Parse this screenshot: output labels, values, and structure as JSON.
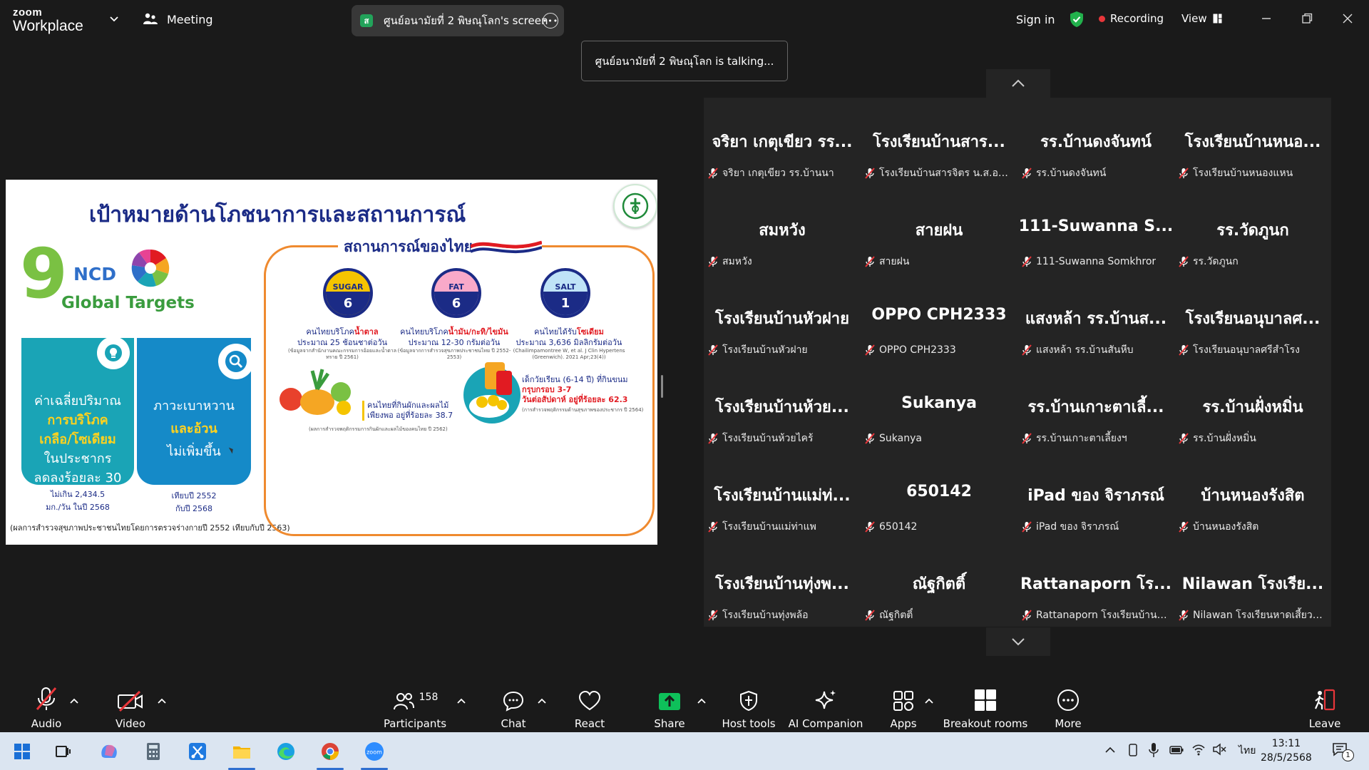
{
  "topbar": {
    "logo_line1": "zoom",
    "logo_line2": "Workplace",
    "meeting_label": "Meeting",
    "share_label": "ศูนย์อนามัยที่ 2 พิษณุโลก's screen",
    "signin": "Sign in",
    "recording": "Recording",
    "view": "View"
  },
  "talking": "ศูนย์อนามัยที่ 2 พิษณุโลก is talking...",
  "slide": {
    "title": "เป้าหมายด้านโภชนาการและสถานการณ์",
    "ncd_number": "9",
    "ncd": "NCD",
    "global_targets": "Global Targets",
    "card1": {
      "l1": "ค่าเฉลี่ยปริมาณ",
      "l2": "การบริโภค",
      "l3": "เกลือ/โซเดียม",
      "l4": "ในประชากร",
      "l5": "ลดลงร้อยละ 30"
    },
    "card1_sub": [
      "ไม่เกิน 2,434.5",
      "มก./วัน ในปี 2568"
    ],
    "card2": {
      "l1": "ภาวะเบาหวาน",
      "l2": "และอ้วน",
      "l3": "ไม่เพิ่มขึ้น"
    },
    "card2_sub": [
      "เทียบปี 2552",
      "กับปี 2568"
    ],
    "footnote": "(ผลการสำรวจสุขภาพประชาชนไทยโดยการตรวจร่างกายปี 2552 เทียบกับปี 2563)",
    "thai_title": "สถานการณ์ของไทย",
    "stats": [
      {
        "label": "SUGAR",
        "num": "6",
        "l1": "คนไทยบริโภค",
        "hl": "น้ำตาล",
        "l2": "ประมาณ 25 ช้อนชาต่อวัน",
        "src": "(ข้อมูลจากสำนักงานคณะกรรมการอ้อยและน้ำตาลทราย ปี 2561)"
      },
      {
        "label": "FAT",
        "num": "6",
        "l1": "คนไทยบริโภค",
        "hl": "น้ำมัน/กะทิ/ไขมัน",
        "l2": "ประมาณ 12-30 กรัมต่อวัน",
        "src": "(ข้อมูลจากการสำรวจสุขภาพประชาชนไทย ปี 2552-2553)"
      },
      {
        "label": "SALT",
        "num": "1",
        "l1": "คนไทยได้รับ",
        "hl": "โซเดียม",
        "l2": "ประมาณ 3,636 มิลลิกรัมต่อวัน",
        "src": "(Chailimpamontree W, et al. J Clin Hypertens (Greenwich). 2021 Apr;23(4))"
      }
    ],
    "veg_l1": "คนไทยที่กินผักและผลไม้",
    "veg_l2": "เพียงพอ อยู่ที่ร้อยละ 38.7",
    "veg_src": "(ผลการสำรวจพฤติกรรมการกินผักและผลไม้ของคนไทย ปี 2562)",
    "kid_l1": "เด็กวัยเรียน (6-14 ปี) ที่กินขนม",
    "kid_l2": "กรุบกรอบ 3-7",
    "kid_l3": "วันต่อสัปดาห์ อยู่ที่ร้อยละ 62.3",
    "kid_src": "(การสำรวจพฤติกรรมด้านสุขภาพของประชากร ปี 2564)"
  },
  "participants": [
    {
      "big": "จริยา เกตุเขียว รร...",
      "name": "จริยา เกตุเขียว รร.บ้านนา"
    },
    {
      "big": "โรงเรียนบ้านสาร...",
      "name": "โรงเรียนบ้านสารจิตร น.ส.อนุสรา"
    },
    {
      "big": "รร.บ้านดงจันทน์",
      "name": "รร.บ้านดงจันทน์"
    },
    {
      "big": "โรงเรียนบ้านหนอ...",
      "name": "โรงเรียนบ้านหนองแหน"
    },
    {
      "big": "สมหวัง",
      "name": "สมหวัง"
    },
    {
      "big": "สายฝน",
      "name": "สายฝน"
    },
    {
      "big": "111-Suwanna S...",
      "name": "111-Suwanna Somkhror"
    },
    {
      "big": "รร.วัดภูนก",
      "name": "รร.วัดภูนก"
    },
    {
      "big": "โรงเรียนบ้านหัวฝาย",
      "name": "โรงเรียนบ้านหัวฝาย"
    },
    {
      "big": "OPPO CPH2333",
      "name": "OPPO CPH2333"
    },
    {
      "big": "แสงหล้า รร.บ้านส...",
      "name": "แสงหล้า รร.บ้านสันหีบ"
    },
    {
      "big": "โรงเรียนอนุบาลศ...",
      "name": "โรงเรียนอนุบาลศรีสำโรง"
    },
    {
      "big": "โรงเรียนบ้านห้วย...",
      "name": "โรงเรียนบ้านห้วยไคร้"
    },
    {
      "big": "Sukanya",
      "name": "Sukanya"
    },
    {
      "big": "รร.บ้านเกาะตาเลี้...",
      "name": "รร.บ้านเกาะตาเลี้ยงฯ"
    },
    {
      "big": "รร.บ้านฝั่งหมิ่น",
      "name": "รร.บ้านฝั่งหมิ่น"
    },
    {
      "big": "โรงเรียนบ้านแม่ท่...",
      "name": "โรงเรียนบ้านแม่ท่าแพ"
    },
    {
      "big": "650142",
      "name": "650142"
    },
    {
      "big": "iPad ของ จิราภรณ์",
      "name": "iPad ของ จิราภรณ์"
    },
    {
      "big": "บ้านหนองรังสิต",
      "name": "บ้านหนองรังสิต"
    },
    {
      "big": "โรงเรียนบ้านทุ่งพ...",
      "name": "โรงเรียนบ้านทุ่งพล้อ"
    },
    {
      "big": "ณัฐกิตติ์",
      "name": "ณัฐกิตติ์"
    },
    {
      "big": "Rattanaporn โร...",
      "name": "Rattanaporn โรงเรียนบ้านนาตาจูม"
    },
    {
      "big": "Nilawan โรงเรีย...",
      "name": "Nilawan โรงเรียนหาดเสี้ยวที่..."
    }
  ],
  "toolbar": {
    "audio": "Audio",
    "video": "Video",
    "participants": "Participants",
    "participants_count": "158",
    "chat": "Chat",
    "react": "React",
    "share": "Share",
    "host_tools": "Host tools",
    "ai_companion": "AI Companion",
    "apps": "Apps",
    "breakout_rooms": "Breakout rooms",
    "more": "More",
    "leave": "Leave"
  },
  "taskbar": {
    "lang": "ไทย",
    "time": "13:11",
    "date": "28/5/2568",
    "notif_count": "1"
  },
  "colors": {
    "zoom_bg": "#1a1a1a",
    "gallery_bg": "#242424",
    "share_green": "#0ec05a",
    "record_red": "#e8363a",
    "slide_navy": "#1b2b86"
  }
}
